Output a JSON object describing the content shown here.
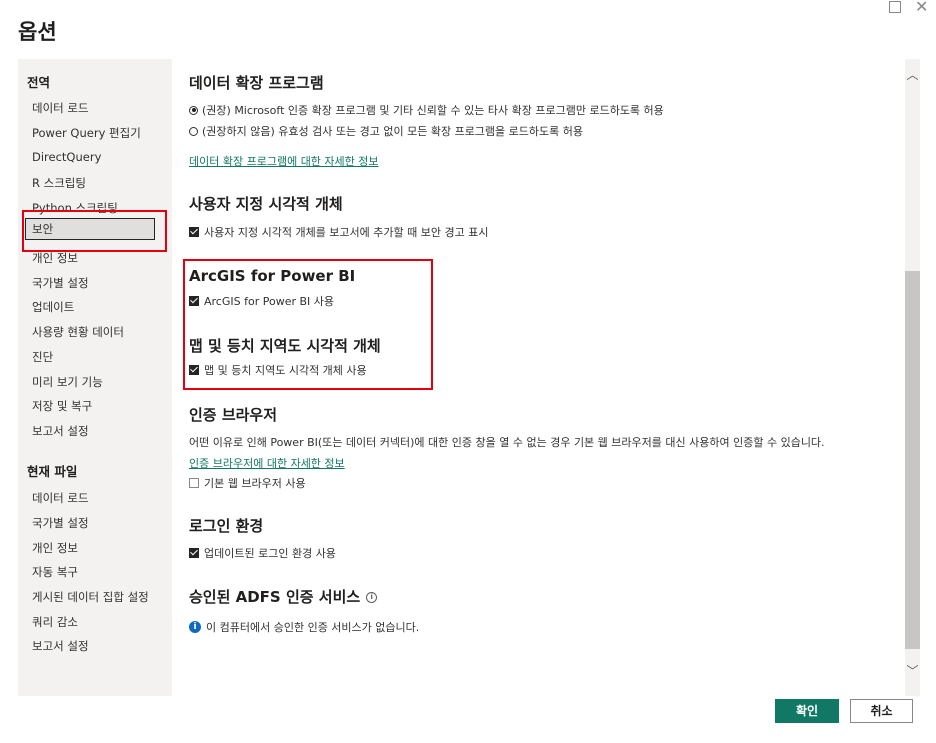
{
  "window": {
    "title": "옵션",
    "maximize_glyph": "",
    "close_glyph": "✕"
  },
  "sidebar": {
    "global_header": "전역",
    "global_items": [
      {
        "label": "데이터 로드"
      },
      {
        "label": "Power Query 편집기"
      },
      {
        "label": "DirectQuery"
      },
      {
        "label": "R 스크립팅"
      },
      {
        "label": "Python 스크립팅"
      },
      {
        "label": "보안",
        "selected": true
      },
      {
        "label": "개인 정보"
      },
      {
        "label": "국가별 설정"
      },
      {
        "label": "업데이트"
      },
      {
        "label": "사용량 현황 데이터"
      },
      {
        "label": "진단"
      },
      {
        "label": "미리 보기 기능"
      },
      {
        "label": "저장 및 복구"
      },
      {
        "label": "보고서 설정"
      }
    ],
    "current_header": "현재 파일",
    "current_items": [
      {
        "label": "데이터 로드"
      },
      {
        "label": "국가별 설정"
      },
      {
        "label": "개인 정보"
      },
      {
        "label": "자동 복구"
      },
      {
        "label": "게시된 데이터 집합 설정"
      },
      {
        "label": "쿼리 감소"
      },
      {
        "label": "보고서 설정"
      }
    ]
  },
  "content": {
    "extensions": {
      "heading": "데이터 확장 프로그램",
      "option_recommended": "(권장) Microsoft 인증 확장 프로그램 및 기타 신뢰할 수 있는 타사 확장 프로그램만 로드하도록 허용",
      "option_not_recommended": "(권장하지 않음) 유효성 검사 또는 경고 없이 모든 확장 프로그램을 로드하도록 허용",
      "selected": "recommended",
      "link": "데이터 확장 프로그램에 대한 자세한 정보"
    },
    "custom_visuals": {
      "heading": "사용자 지정 시각적 개체",
      "checkbox_label": "사용자 지정 시각적 개체를 보고서에 추가할 때 보안 경고 표시",
      "checked": true
    },
    "arcgis": {
      "heading": "ArcGIS for Power BI",
      "checkbox_label": "ArcGIS for Power BI 사용",
      "checked": true
    },
    "maps": {
      "heading": "맵 및 등치 지역도 시각적 개체",
      "checkbox_label": "맵 및 등치 지역도 시각적 개체 사용",
      "checked": true
    },
    "auth_browser": {
      "heading": "인증 브라우저",
      "description": "어떤 이유로 인해 Power BI(또는 데이터 커넥터)에 대한 인증 창을 열 수 없는 경우 기본 웹 브라우저를 대신 사용하여 인증할 수 있습니다.",
      "link": "인증 브라우저에 대한 자세한 정보",
      "checkbox_label": "기본 웹 브라우저 사용",
      "checked": false
    },
    "login": {
      "heading": "로그인 환경",
      "checkbox_label": "업데이트된 로그인 환경 사용",
      "checked": true
    },
    "adfs": {
      "heading": "승인된 ADFS 인증 서비스",
      "info_text": "이 컴퓨터에서 승인한 인증 서비스가 없습니다."
    }
  },
  "buttons": {
    "ok": "확인",
    "cancel": "취소"
  },
  "colors": {
    "accent": "#117865",
    "highlight_border": "#e3000f",
    "info": "#0f6cbd"
  }
}
